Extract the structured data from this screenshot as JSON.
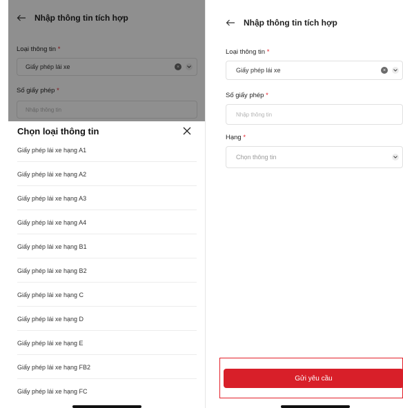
{
  "left": {
    "header_title": "Nhập thông tin tích hợp",
    "type_label": "Loại thông tin",
    "type_value": "Giấy phép lái xe",
    "license_label": "Số giấy phép",
    "license_placeholder": "Nhập thông tin",
    "sheet": {
      "title": "Chọn loại thông tin",
      "options": [
        "Giấy phép lái xe hạng A1",
        "Giấy phép lái xe hạng A2",
        "Giấy phép lái xe hạng A3",
        "Giấy phép lái xe hạng A4",
        "Giấy phép lái xe hạng B1",
        "Giấy phép lái xe hạng B2",
        "Giấy phép lái xe hạng C",
        "Giấy phép lái xe hạng D",
        "Giấy phép lái xe hạng E",
        "Giấy phép lái xe hạng FB2",
        "Giấy phép lái xe hạng FC"
      ]
    }
  },
  "right": {
    "header_title": "Nhập thông tin tích hợp",
    "type_label": "Loại thông tin",
    "type_value": "Giấy phép lái xe",
    "license_label": "Số giấy phép",
    "license_placeholder": "Nhập thông tin",
    "rank_label": "Hạng",
    "rank_placeholder": "Chọn thông tin",
    "submit_label": "Gửi yêu cầu"
  },
  "required_mark": "*",
  "colors": {
    "accent": "#d81f29",
    "overlay": "rgba(0,0,0,0.44)"
  }
}
